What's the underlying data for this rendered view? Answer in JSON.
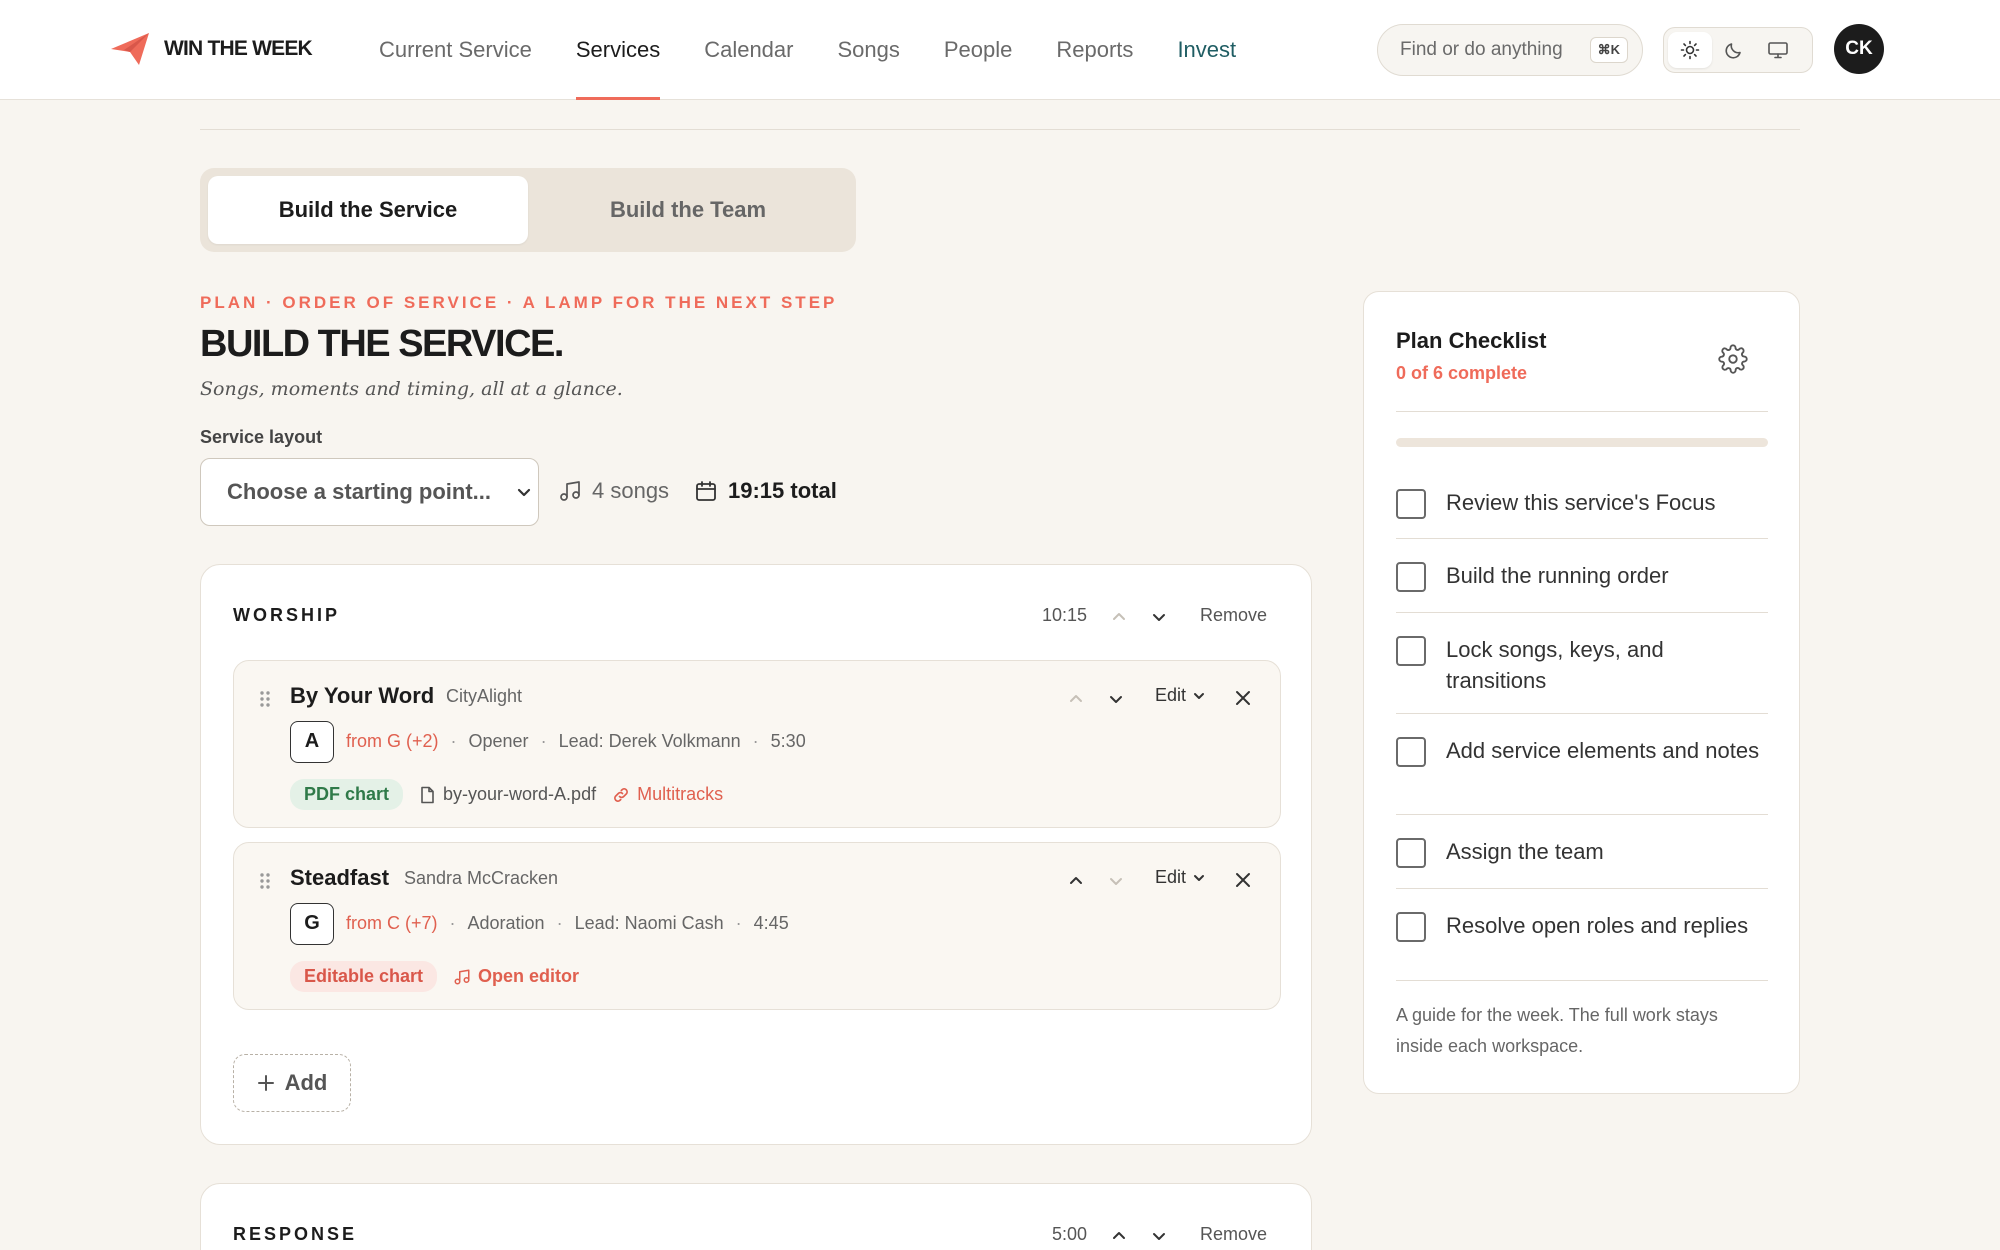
{
  "brand": {
    "name": "WIN THE WEEK",
    "logo_icon": "paper-plane-icon",
    "accent": "#ef6b5a"
  },
  "nav": {
    "items": [
      {
        "label": "Current Service",
        "active": false
      },
      {
        "label": "Services",
        "active": true
      },
      {
        "label": "Calendar",
        "active": false
      },
      {
        "label": "Songs",
        "active": false
      },
      {
        "label": "People",
        "active": false
      },
      {
        "label": "Reports",
        "active": false
      },
      {
        "label": "Invest",
        "active": false
      }
    ]
  },
  "search": {
    "placeholder": "Find or do anything",
    "shortcut": "⌘K"
  },
  "theme": {
    "options": [
      "light",
      "dark",
      "system"
    ],
    "selected": "light"
  },
  "user": {
    "initials": "CK"
  },
  "tabs": {
    "build_service": "Build the Service",
    "build_team": "Build the Team",
    "active": "build_service"
  },
  "header": {
    "eyebrow": "PLAN · ORDER OF SERVICE · A LAMP FOR THE NEXT STEP",
    "title": "BUILD THE SERVICE.",
    "subtitle": "Songs, moments and timing, all at a glance."
  },
  "layout": {
    "label": "Service layout",
    "placeholder": "Choose a starting point...",
    "songs_count": "4 songs",
    "total": "19:15 total"
  },
  "sections": [
    {
      "title": "WORSHIP",
      "duration": "10:15",
      "remove_label": "Remove",
      "songs": [
        {
          "title": "By Your Word",
          "artist": "CityAlight",
          "key": "A",
          "from": "from G (+2)",
          "role": "Opener",
          "lead": "Lead: Derek Volkmann",
          "duration": "5:30",
          "edit_label": "Edit",
          "chart_tag": "PDF chart",
          "file": "by-your-word-A.pdf",
          "link": "Multitracks"
        },
        {
          "title": "Steadfast",
          "artist": "Sandra McCracken",
          "key": "G",
          "from": "from C (+7)",
          "role": "Adoration",
          "lead": "Lead: Naomi Cash",
          "duration": "4:45",
          "edit_label": "Edit",
          "chart_tag": "Editable chart",
          "link": "Open editor"
        }
      ],
      "add_label": "Add"
    },
    {
      "title": "RESPONSE",
      "duration": "5:00",
      "remove_label": "Remove"
    }
  ],
  "checklist": {
    "title": "Plan Checklist",
    "count": "0 of 6 complete",
    "progress": 0,
    "items": [
      {
        "label": "Review this service's Focus",
        "checked": false
      },
      {
        "label": "Build the running order",
        "checked": false
      },
      {
        "label": "Lock songs, keys, and transitions",
        "checked": false
      },
      {
        "label": "Add service elements and notes",
        "checked": false
      },
      {
        "label": "Assign the team",
        "checked": false
      },
      {
        "label": "Resolve open roles and replies",
        "checked": false
      }
    ],
    "footer": "A guide for the week. The full work stays inside each workspace."
  }
}
